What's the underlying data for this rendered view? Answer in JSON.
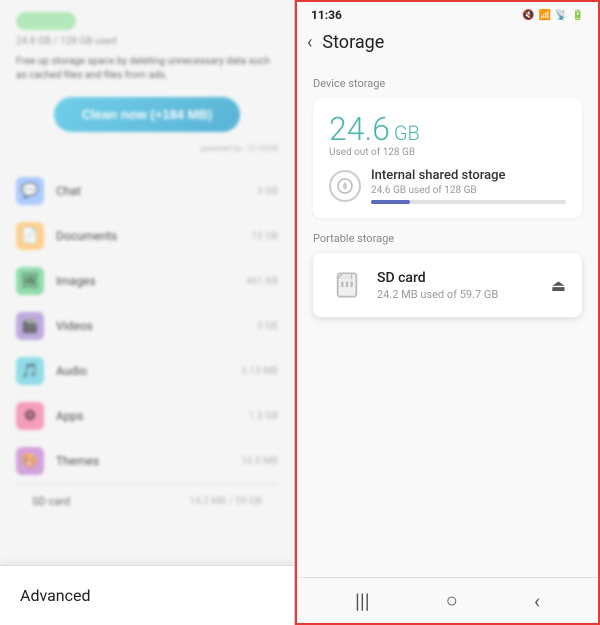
{
  "left_panel": {
    "storage_bar_color": "#a8e6b0",
    "storage_info": "24.8 GB / 128 GB used",
    "free_up_text": "Free up storage space by deleting unnecessary data such as cached files and files from ads.",
    "clean_button_label": "Clean now (+184 MB)",
    "powered_text": "powered by · 21/2020",
    "storage_items": [
      {
        "name": "Chat",
        "size": "3 GB",
        "icon_class": "icon-chat",
        "icon": "💬"
      },
      {
        "name": "Documents",
        "size": "12 GB",
        "icon_class": "icon-docs",
        "icon": "📄"
      },
      {
        "name": "Images",
        "size": "461 KB",
        "icon_class": "icon-images",
        "icon": "🖼"
      },
      {
        "name": "Videos",
        "size": "3 GB",
        "icon_class": "icon-videos",
        "icon": "🎬"
      },
      {
        "name": "Audio",
        "size": "3.13 MB",
        "icon_class": "icon-audio",
        "icon": "🎵"
      },
      {
        "name": "Apps",
        "size": "1.3 GB",
        "icon_class": "icon-apps",
        "icon": "⚙"
      },
      {
        "name": "Themes",
        "size": "10.5 MB",
        "icon_class": "icon-themes",
        "icon": "🎨"
      }
    ],
    "sd_card_label": "SD card",
    "sd_card_size": "14.2 MB / 59 GB",
    "advanced_label": "Advanced"
  },
  "right_panel": {
    "status_time": "11:36",
    "status_icons": [
      "🔇",
      "📶",
      "📡",
      "🔋"
    ],
    "back_icon": "‹",
    "page_title": "Storage",
    "device_storage_section_label": "Device storage",
    "device_storage_size": "24.6",
    "device_storage_unit": "GB",
    "device_storage_used_text": "Used out of 128 GB",
    "internal_storage_name": "Internal shared storage",
    "internal_storage_sub": "24.6 GB used of 128 GB",
    "progress_percent": 20,
    "portable_section_label": "Portable storage",
    "sd_card_name": "SD card",
    "sd_card_detail": "24.2 MB used of 59.7 GB",
    "eject_icon": "⏏",
    "nav_icons": [
      "|||",
      "○",
      "‹"
    ]
  }
}
